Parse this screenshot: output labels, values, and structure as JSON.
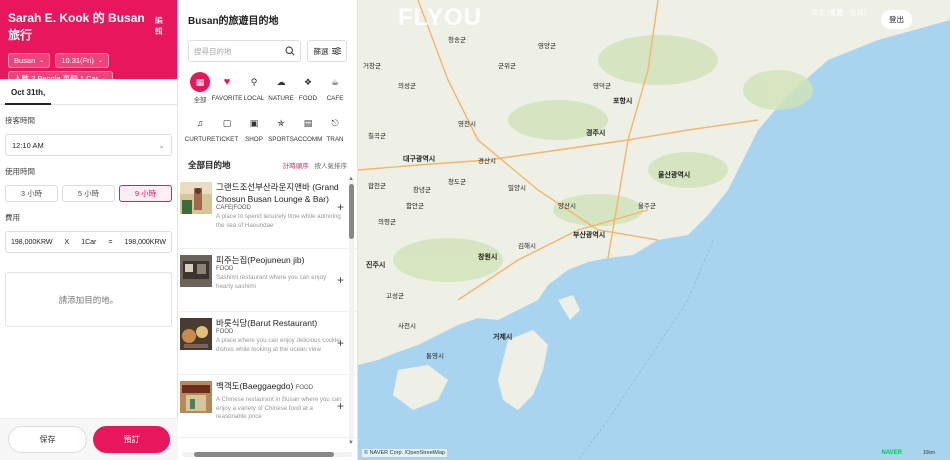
{
  "left_panel": {
    "trip_title": "Sarah E. Kook 的 Busan 旅行",
    "edit_label": "編輯",
    "city": "Busan",
    "date": "10.31(Fri)",
    "passengers": "人數 2 People 車輛 1 Car",
    "date_tab": "Oct 31th,",
    "time_label": "接客時間",
    "time_value": "12:10 AM",
    "usage_label": "使用時間",
    "hour_options": [
      "3 小時",
      "5 小時",
      "9 小時"
    ],
    "hour_selected": "9 小時",
    "cost_label": "費用",
    "cost": {
      "unit_price": "198,000KRW",
      "times": "X",
      "cars": "1Car",
      "equals": "=",
      "total": "198,000KRW"
    },
    "add_destination": "請添加目的地。",
    "save_label": "保存",
    "book_label": "預訂",
    "brand_color": "#e8175d"
  },
  "middle_panel": {
    "title": "Busan的旅遊目的地",
    "search_placeholder": "搜尋目的地",
    "filter_label": "篩選",
    "categories": [
      {
        "label": "全部",
        "icon": "grid-icon"
      },
      {
        "label": "FAVORITE",
        "icon": "heart-icon"
      },
      {
        "label": "LOCAL",
        "icon": "pin-icon"
      },
      {
        "label": "NATURE",
        "icon": "tree-icon"
      },
      {
        "label": "FOOD",
        "icon": "fork-icon"
      },
      {
        "label": "CAFE",
        "icon": "cup-icon"
      },
      {
        "label": "CURTURE",
        "icon": "music-icon"
      },
      {
        "label": "TICKET",
        "icon": "ticket-icon"
      },
      {
        "label": "SHOP",
        "icon": "bag-icon"
      },
      {
        "label": "SPORTS",
        "icon": "run-icon"
      },
      {
        "label": "ACCOMM",
        "icon": "bed-icon"
      },
      {
        "label": "TRAN",
        "icon": "car-icon"
      }
    ],
    "list_title": "全部目的地",
    "sort_active": "計時順序",
    "sort_other": "按人氣排序",
    "places": [
      {
        "name": "그랜드조선부산라운지앤바 (Grand Chosun Busan Lounge & Bar)",
        "category": "CAFE|FOOD",
        "desc": "A place to spend leisurely time while admiring the sea of Haeundae"
      },
      {
        "name": "피주는집(Peojuneun jib)",
        "category": "FOOD",
        "desc": "Sashimi restaurant where you can enjoy hearty sashimi"
      },
      {
        "name": "바릇식당(Barut Restaurant)",
        "category": "FOOD",
        "desc": "A place where you can enjoy delicious cockle dishes while looking at the ocean view"
      },
      {
        "name": "백객도(Baeggaegdo)",
        "category": "FOOD",
        "desc": "A Chinese restaurant in Busan where you can enjoy a variety of Chinese food at a reasonable price"
      }
    ]
  },
  "map": {
    "logo": "FLYOU",
    "language": "中文 (繁體 - 台灣)",
    "logout_label": "登出",
    "labels": [
      "청송군",
      "영양군",
      "영덕군",
      "칠곡군",
      "의성군",
      "영천시",
      "포항시",
      "경주시",
      "대구광역시",
      "경산시",
      "청도군",
      "밀양시",
      "울산광역시",
      "양산시",
      "김해시",
      "창원시",
      "부산광역시",
      "함안군",
      "의령군",
      "진주시",
      "고성군",
      "통영시",
      "거제시",
      "합천군",
      "창녕군",
      "군위군",
      "울주군",
      "거창군",
      "사천시"
    ],
    "attribution": "© NAVER Corp. /OpenStreetMap",
    "naver": "NAVER",
    "scale": "10km"
  }
}
